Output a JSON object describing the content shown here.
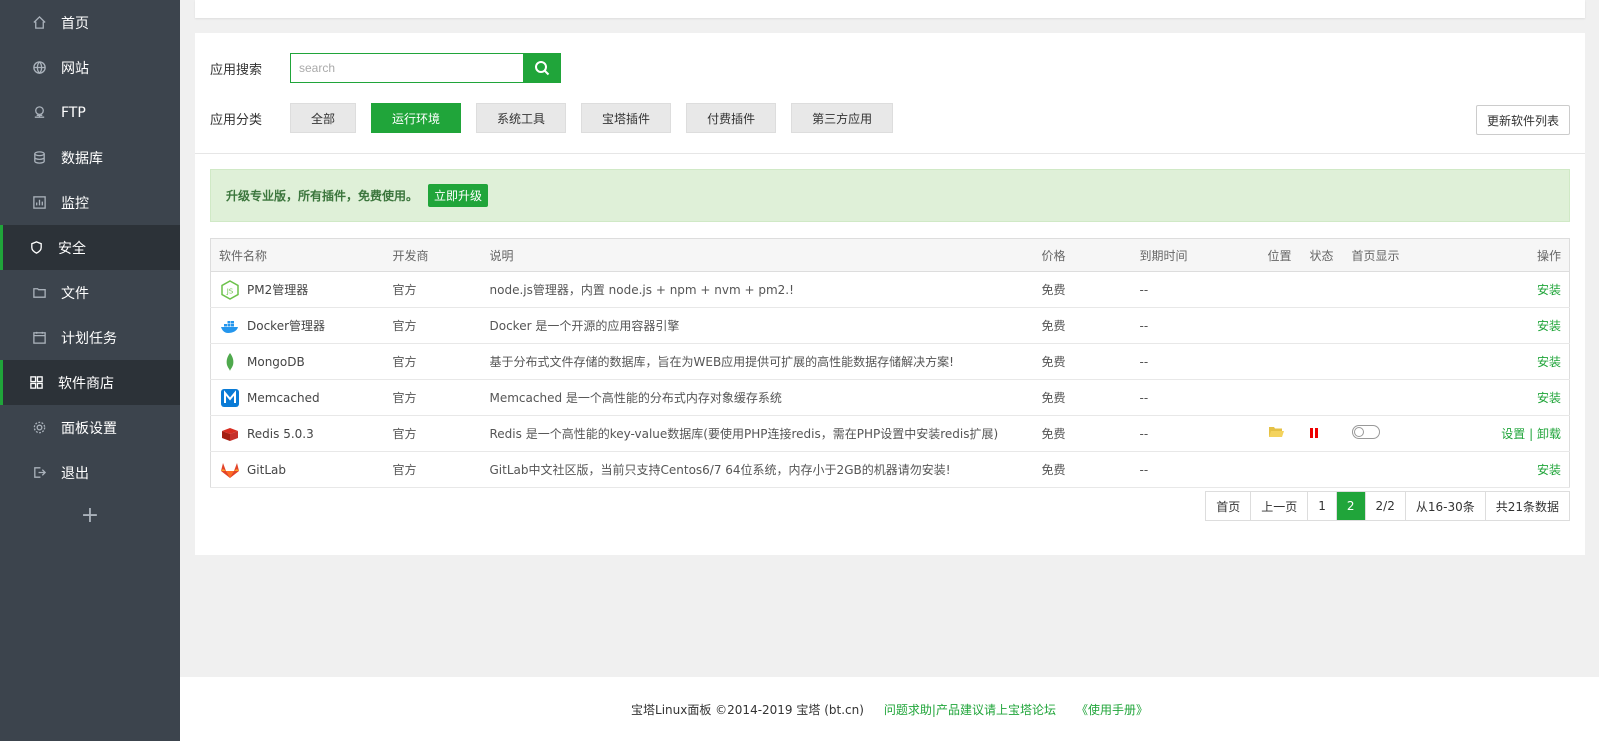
{
  "sidebar": {
    "items": [
      {
        "label": "首页",
        "icon": "home-icon"
      },
      {
        "label": "网站",
        "icon": "globe-icon"
      },
      {
        "label": "FTP",
        "icon": "ftp-icon"
      },
      {
        "label": "数据库",
        "icon": "database-icon"
      },
      {
        "label": "监控",
        "icon": "monitor-icon"
      },
      {
        "label": "安全",
        "icon": "shield-icon"
      },
      {
        "label": "文件",
        "icon": "folder-icon"
      },
      {
        "label": "计划任务",
        "icon": "calendar-icon"
      },
      {
        "label": "软件商店",
        "icon": "grid-icon"
      },
      {
        "label": "面板设置",
        "icon": "gear-icon"
      },
      {
        "label": "退出",
        "icon": "logout-icon"
      }
    ],
    "add_label": "+"
  },
  "search": {
    "label": "应用搜索",
    "placeholder": "search"
  },
  "category": {
    "label": "应用分类",
    "buttons": [
      "全部",
      "运行环境",
      "系统工具",
      "宝塔插件",
      "付费插件",
      "第三方应用"
    ],
    "refresh_label": "更新软件列表"
  },
  "promo": {
    "text": "升级专业版，所有插件，免费使用。",
    "button": "立即升级"
  },
  "table": {
    "headers": [
      "软件名称",
      "开发商",
      "说明",
      "价格",
      "到期时间",
      "位置",
      "状态",
      "首页显示",
      "操作"
    ],
    "rows": [
      {
        "name": "PM2管理器",
        "vendor": "官方",
        "desc": "node.js管理器，内置 node.js + npm + nvm + pm2.!",
        "price": "免费",
        "expire": "--",
        "action": "安装"
      },
      {
        "name": "Docker管理器",
        "vendor": "官方",
        "desc": "Docker 是一个开源的应用容器引擎",
        "price": "免费",
        "expire": "--",
        "action": "安装"
      },
      {
        "name": "MongoDB",
        "vendor": "官方",
        "desc": "基于分布式文件存储的数据库，旨在为WEB应用提供可扩展的高性能数据存储解决方案!",
        "price": "免费",
        "expire": "--",
        "action": "安装"
      },
      {
        "name": "Memcached",
        "vendor": "官方",
        "desc": "Memcached 是一个高性能的分布式内存对象缓存系统",
        "price": "免费",
        "expire": "--",
        "action": "安装"
      },
      {
        "name": "Redis 5.0.3",
        "vendor": "官方",
        "desc": "Redis 是一个高性能的key-value数据库(要使用PHP连接redis，需在PHP设置中安装redis扩展)",
        "price": "免费",
        "expire": "--",
        "action_set": "设置",
        "action_sep": "|",
        "action_uninstall": "卸载"
      },
      {
        "name": "GitLab",
        "vendor": "官方",
        "desc": "GitLab中文社区版，当前只支持Centos6/7 64位系统，内存小于2GB的机器请勿安装!",
        "price": "免费",
        "expire": "--",
        "action": "安装"
      }
    ]
  },
  "pager": [
    "首页",
    "上一页",
    "1",
    "2",
    "2/2",
    "从16-30条",
    "共21条数据"
  ],
  "footer": {
    "copyright": "宝塔Linux面板 ©2014-2019 宝塔 (bt.cn)",
    "forum": "问题求助|产品建议请上宝塔论坛",
    "manual": "《使用手册》"
  },
  "colors": {
    "accent": "#20a53a",
    "sidebar_bg": "#3c444d"
  }
}
